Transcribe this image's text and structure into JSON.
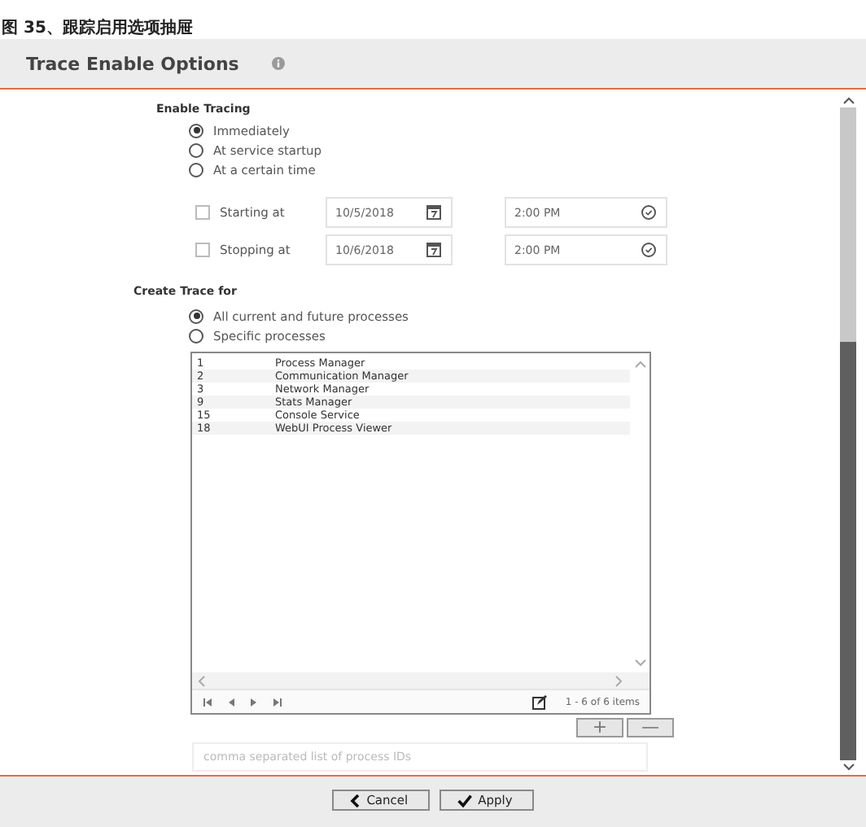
{
  "caption": "图 35、跟踪启用选项抽屉",
  "panel": {
    "title": "Trace Enable Options"
  },
  "enable_tracing": {
    "heading": "Enable Tracing",
    "options": [
      {
        "label": "Immediately",
        "selected": true
      },
      {
        "label": "At service startup",
        "selected": false
      },
      {
        "label": "At a certain time",
        "selected": false
      }
    ],
    "schedule": [
      {
        "label": "Starting at",
        "checked": false,
        "date": "10/5/2018",
        "time": "2:00 PM"
      },
      {
        "label": "Stopping at",
        "checked": false,
        "date": "10/6/2018",
        "time": "2:00 PM"
      }
    ]
  },
  "create_trace_for": {
    "heading": "Create Trace for",
    "options": [
      {
        "label": "All current and future processes",
        "selected": true
      },
      {
        "label": "Specific processes",
        "selected": false
      }
    ],
    "processes": {
      "rows": [
        {
          "id": "1",
          "name": "Process Manager"
        },
        {
          "id": "2",
          "name": "Communication Manager"
        },
        {
          "id": "3",
          "name": "Network Manager"
        },
        {
          "id": "9",
          "name": "Stats Manager"
        },
        {
          "id": "15",
          "name": "Console Service"
        },
        {
          "id": "18",
          "name": "WebUI Process Viewer"
        }
      ],
      "pager": "1 - 6 of 6 items"
    },
    "add_button": "+",
    "remove_button": "—",
    "id_field": {
      "placeholder": "comma separated list of process IDs"
    }
  },
  "buttons": [
    {
      "label": "Cancel",
      "kind": "cancel"
    },
    {
      "label": "Apply",
      "kind": "apply"
    }
  ]
}
